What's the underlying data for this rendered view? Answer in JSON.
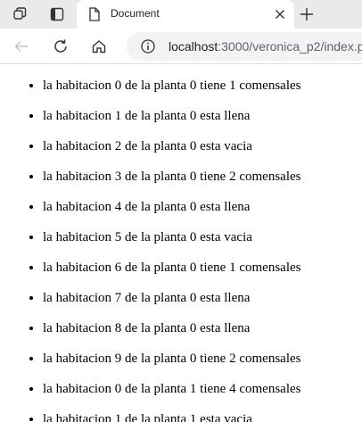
{
  "browser": {
    "tab": {
      "title": "Document",
      "icon": "document-icon",
      "close_icon": "close-icon"
    },
    "toolbar_icons": [
      "collections-icon",
      "tab-actions-icon",
      "new-tab-icon"
    ],
    "nav_icons": [
      "back-icon",
      "refresh-icon",
      "home-icon",
      "site-info-icon"
    ],
    "address": {
      "host": "localhost",
      "path": ":3000/veronica_p2/index.p"
    }
  },
  "page": {
    "rooms": [
      "la habitacion 0 de la planta 0 tiene 1 comensales",
      "la habitacion 1 de la planta 0 esta llena",
      "la habitacion 2 de la planta 0 esta vacia",
      "la habitacion 3 de la planta 0 tiene 2 comensales",
      "la habitacion 4 de la planta 0 esta llena",
      "la habitacion 5 de la planta 0 esta vacia",
      "la habitacion 6 de la planta 0 tiene 1 comensales",
      "la habitacion 7 de la planta 0 esta llena",
      "la habitacion 8 de la planta 0 esta llena",
      "la habitacion 9 de la planta 0 tiene 2 comensales",
      "la habitacion 0 de la planta 1 tiene 4 comensales",
      "la habitacion 1 de la planta 1 esta vacia"
    ]
  }
}
